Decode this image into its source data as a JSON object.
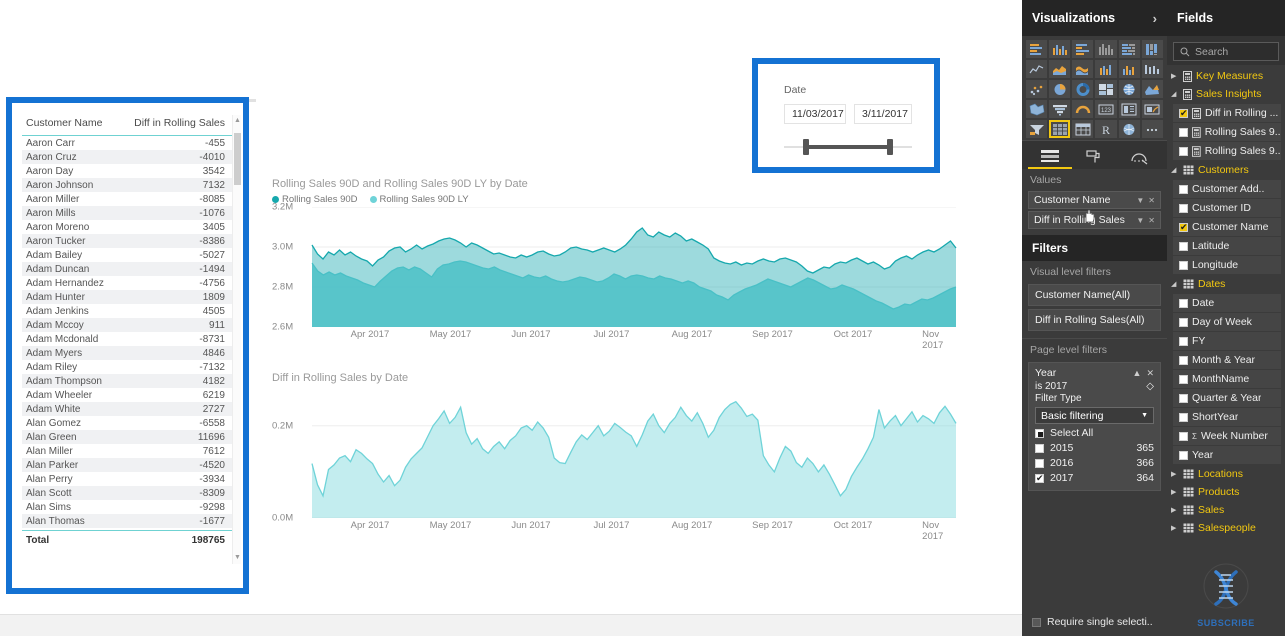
{
  "table_visual": {
    "columns": [
      "Customer Name",
      "Diff in Rolling Sales"
    ],
    "rows": [
      {
        "name": "Aaron Carr",
        "value": "-455"
      },
      {
        "name": "Aaron Cruz",
        "value": "-4010"
      },
      {
        "name": "Aaron Day",
        "value": "3542"
      },
      {
        "name": "Aaron Johnson",
        "value": "7132"
      },
      {
        "name": "Aaron Miller",
        "value": "-8085"
      },
      {
        "name": "Aaron Mills",
        "value": "-1076"
      },
      {
        "name": "Aaron Moreno",
        "value": "3405"
      },
      {
        "name": "Aaron Tucker",
        "value": "-8386"
      },
      {
        "name": "Adam Bailey",
        "value": "-5027"
      },
      {
        "name": "Adam Duncan",
        "value": "-1494"
      },
      {
        "name": "Adam Hernandez",
        "value": "-4756"
      },
      {
        "name": "Adam Hunter",
        "value": "1809"
      },
      {
        "name": "Adam Jenkins",
        "value": "4505"
      },
      {
        "name": "Adam Mccoy",
        "value": "911"
      },
      {
        "name": "Adam Mcdonald",
        "value": "-8731"
      },
      {
        "name": "Adam Myers",
        "value": "4846"
      },
      {
        "name": "Adam Riley",
        "value": "-7132"
      },
      {
        "name": "Adam Thompson",
        "value": "4182"
      },
      {
        "name": "Adam Wheeler",
        "value": "6219"
      },
      {
        "name": "Adam White",
        "value": "2727"
      },
      {
        "name": "Alan Gomez",
        "value": "-6558"
      },
      {
        "name": "Alan Green",
        "value": "11696"
      },
      {
        "name": "Alan Miller",
        "value": "7612"
      },
      {
        "name": "Alan Parker",
        "value": "-4520"
      },
      {
        "name": "Alan Perry",
        "value": "-3934"
      },
      {
        "name": "Alan Scott",
        "value": "-8309"
      },
      {
        "name": "Alan Sims",
        "value": "-9298"
      },
      {
        "name": "Alan Thomas",
        "value": "-1677"
      }
    ],
    "total_label": "Total",
    "total_value": "198765"
  },
  "date_slicer": {
    "label": "Date",
    "start": "11/03/2017",
    "end": "3/11/2017"
  },
  "chart_data": [
    {
      "type": "area",
      "title": "Rolling Sales 90D and Rolling Sales 90D LY by Date",
      "xlabel": "",
      "ylabel": "",
      "ylim": [
        2600000,
        3200000
      ],
      "yticks": [
        "2.6M",
        "2.8M",
        "3.0M",
        "3.2M"
      ],
      "xticks": [
        "Apr 2017",
        "May 2017",
        "Jun 2017",
        "Jul 2017",
        "Aug 2017",
        "Sep 2017",
        "Oct 2017",
        "Nov 2017"
      ],
      "legend": [
        {
          "name": "Rolling Sales 90D",
          "color": "#16a8ad"
        },
        {
          "name": "Rolling Sales 90D LY",
          "color": "#6fd3d8"
        }
      ],
      "grid": true,
      "series": [
        {
          "name": "Rolling Sales 90D",
          "color": "#16a8ad",
          "values": [
            3010,
            2965,
            2940,
            2975,
            2960,
            2985,
            2960,
            2975,
            2955,
            2940,
            2930,
            2905,
            2935,
            2950,
            2980,
            2995,
            3000,
            2975,
            2990,
            3010,
            2990,
            3005,
            3015,
            3030,
            3040,
            3045,
            3035,
            3020,
            3000,
            3020,
            3010,
            2995,
            2980,
            2965,
            2970,
            2960,
            2950,
            2945,
            2960,
            2950,
            2960,
            2975,
            2980,
            2965,
            2955,
            2960,
            2975,
            2995,
            3000,
            2990,
            2985,
            2975,
            2985,
            2995,
            2985,
            2975,
            2990,
            3010,
            3040,
            3075,
            3095,
            3060,
            3050,
            3075,
            3060,
            3050,
            3070,
            3055,
            3030,
            3040,
            3025,
            3010,
            2990,
            2945,
            2930,
            2920,
            2915,
            2925,
            2910,
            2920,
            2915,
            2930,
            2940,
            2930,
            2925,
            2940,
            2945,
            2935,
            2925,
            2905,
            2880,
            2870,
            2885,
            2900,
            2895,
            2915,
            2925,
            2920,
            2935,
            2945,
            2930,
            2915,
            2925,
            2910,
            2890,
            2900,
            2930,
            2945,
            2955,
            2940,
            2960,
            2975,
            2985,
            2975,
            2990,
            3010,
            3030,
            2995
          ]
        },
        {
          "name": "Rolling Sales 90D LY",
          "color": "#6fd3d8",
          "values": [
            2920,
            2880,
            2860,
            2875,
            2860,
            2870,
            2855,
            2845,
            2835,
            2820,
            2810,
            2800,
            2830,
            2855,
            2880,
            2895,
            2900,
            2885,
            2900,
            2890,
            2870,
            2850,
            2890,
            2910,
            2915,
            2925,
            2930,
            2925,
            2915,
            2905,
            2895,
            2890,
            2900,
            2885,
            2875,
            2865,
            2855,
            2845,
            2860,
            2850,
            2845,
            2855,
            2840,
            2830,
            2825,
            2830,
            2840,
            2850,
            2845,
            2835,
            2825,
            2830,
            2845,
            2865,
            2855,
            2840,
            2855,
            2860,
            2855,
            2845,
            2840,
            2855,
            2845,
            2840,
            2830,
            2820,
            2830,
            2820,
            2800,
            2790,
            2780,
            2760,
            2750,
            2735,
            2760,
            2775,
            2790,
            2800,
            2810,
            2825,
            2840,
            2830,
            2820,
            2810,
            2800,
            2815,
            2830,
            2845,
            2835,
            2820,
            2805,
            2790,
            2795,
            2810,
            2800,
            2790,
            2775,
            2760,
            2745,
            2730,
            2720,
            2705,
            2690,
            2700,
            2715,
            2710,
            2725,
            2740,
            2735,
            2745,
            2760,
            2775,
            2790,
            2800
          ]
        }
      ]
    },
    {
      "type": "area",
      "title": "Diff in Rolling Sales by Date",
      "xlabel": "",
      "ylabel": "",
      "ylim": [
        0,
        260000
      ],
      "yticks": [
        "0.0M",
        "0.2M"
      ],
      "xticks": [
        "Apr 2017",
        "May 2017",
        "Jun 2017",
        "Jul 2017",
        "Aug 2017",
        "Sep 2017",
        "Oct 2017",
        "Nov 2017"
      ],
      "legend": [],
      "grid": true,
      "series": [
        {
          "name": "Diff in Rolling Sales",
          "color": "#6fd3d8",
          "values": [
            118,
            72,
            48,
            105,
            115,
            130,
            135,
            122,
            148,
            140,
            128,
            118,
            95,
            78,
            92,
            70,
            82,
            110,
            128,
            140,
            152,
            176,
            200,
            215,
            232,
            205,
            218,
            240,
            185,
            160,
            172,
            150,
            140,
            155,
            165,
            150,
            168,
            178,
            195,
            200,
            190,
            208,
            195,
            175,
            130,
            120,
            118,
            142,
            165,
            180,
            170,
            185,
            200,
            178,
            188,
            205,
            196,
            186,
            178,
            155,
            180,
            210,
            225,
            200,
            185,
            205,
            218,
            240,
            222,
            210,
            228,
            205,
            175,
            190,
            218,
            235,
            246,
            252,
            238,
            220,
            225,
            212,
            135,
            115,
            100,
            130,
            155,
            145,
            120,
            110,
            130,
            118,
            100,
            115,
            95,
            72,
            48,
            62,
            90,
            110,
            128,
            150,
            175,
            235,
            195,
            210,
            222,
            200,
            215,
            230,
            208,
            222,
            215,
            205,
            228,
            242,
            225,
            205
          ]
        }
      ]
    }
  ],
  "visualizations": {
    "title": "Visualizations",
    "collapse_icon": "chevron-right-icon",
    "icons": [
      "stacked-bar-chart",
      "stacked-column-chart",
      "clustered-bar-chart",
      "clustered-column-chart",
      "100-stacked-bar-chart",
      "100-stacked-column-chart",
      "line-chart",
      "area-chart",
      "stacked-area-chart",
      "line-and-stacked-column-chart",
      "line-and-clustered-column-chart",
      "ribbon-chart",
      "scatter-chart",
      "pie-chart",
      "donut-chart",
      "treemap",
      "map",
      "filled-map",
      "shape-map",
      "funnel-chart",
      "gauge-chart",
      "card",
      "multi-row-card",
      "kpi",
      "slicer",
      "table",
      "matrix",
      "r-script-visual",
      "python-visual",
      "more-options"
    ],
    "selected_icon": "table",
    "tabs": [
      "fields-tab",
      "format-tab",
      "analytics-tab"
    ],
    "active_tab": "fields-tab",
    "values_section_label": "Values",
    "values": [
      "Customer Name",
      "Diff in Rolling Sales"
    ]
  },
  "filters": {
    "title": "Filters",
    "visual_level_label": "Visual level filters",
    "visual_level": [
      "Customer Name(All)",
      "Diff in Rolling Sales(All)"
    ],
    "page_level_label": "Page level filters",
    "page_filter": {
      "field": "Year",
      "condition": "is 2017",
      "filter_type_label": "Filter Type",
      "filter_type_value": "Basic filtering",
      "select_all_label": "Select All",
      "items": [
        {
          "label": "2015",
          "count": "365",
          "checked": false
        },
        {
          "label": "2016",
          "count": "366",
          "checked": false
        },
        {
          "label": "2017",
          "count": "364",
          "checked": true
        }
      ]
    },
    "require_single_label": "Require single selecti.."
  },
  "fields": {
    "title": "Fields",
    "search_placeholder": "Search",
    "tree": [
      {
        "kind": "table",
        "label": "Key Measures",
        "expanded": false,
        "icon": "measure-table-icon"
      },
      {
        "kind": "table",
        "label": "Sales Insights",
        "expanded": true,
        "icon": "measure-table-icon"
      },
      {
        "kind": "field",
        "label": "Diff in Rolling ...",
        "checked": true,
        "icon": "measure-icon"
      },
      {
        "kind": "field",
        "label": "Rolling Sales 9...",
        "checked": false,
        "icon": "measure-icon"
      },
      {
        "kind": "field",
        "label": "Rolling Sales 9...",
        "checked": false,
        "icon": "measure-icon"
      },
      {
        "kind": "table",
        "label": "Customers",
        "expanded": true,
        "icon": "table-icon"
      },
      {
        "kind": "field",
        "label": "Customer Add..",
        "checked": false,
        "icon": ""
      },
      {
        "kind": "field",
        "label": "Customer ID",
        "checked": false,
        "icon": ""
      },
      {
        "kind": "field",
        "label": "Customer Name",
        "checked": true,
        "icon": ""
      },
      {
        "kind": "field",
        "label": "Latitude",
        "checked": false,
        "icon": ""
      },
      {
        "kind": "field",
        "label": "Longitude",
        "checked": false,
        "icon": ""
      },
      {
        "kind": "table",
        "label": "Dates",
        "expanded": true,
        "icon": "table-icon"
      },
      {
        "kind": "field",
        "label": "Date",
        "checked": false,
        "icon": ""
      },
      {
        "kind": "field",
        "label": "Day of Week",
        "checked": false,
        "icon": ""
      },
      {
        "kind": "field",
        "label": "FY",
        "checked": false,
        "icon": ""
      },
      {
        "kind": "field",
        "label": "Month & Year",
        "checked": false,
        "icon": ""
      },
      {
        "kind": "field",
        "label": "MonthName",
        "checked": false,
        "icon": ""
      },
      {
        "kind": "field",
        "label": "Quarter & Year",
        "checked": false,
        "icon": ""
      },
      {
        "kind": "field",
        "label": "ShortYear",
        "checked": false,
        "icon": ""
      },
      {
        "kind": "field",
        "label": "Week Number",
        "checked": false,
        "icon": "sigma"
      },
      {
        "kind": "field",
        "label": "Year",
        "checked": false,
        "icon": ""
      },
      {
        "kind": "table",
        "label": "Locations",
        "expanded": false,
        "icon": "table-icon"
      },
      {
        "kind": "table",
        "label": "Products",
        "expanded": false,
        "icon": "table-icon"
      },
      {
        "kind": "table",
        "label": "Sales",
        "expanded": false,
        "icon": "table-icon"
      },
      {
        "kind": "table",
        "label": "Salespeople",
        "expanded": false,
        "icon": "table-icon"
      }
    ],
    "watermark_label": "SUBSCRIBE"
  },
  "colors": {
    "selection_blue": "#1472d3",
    "accent_yellow": "#f2c811",
    "series_primary": "#16a8ad",
    "series_secondary": "#6fd3d8",
    "panel_bg": "#3b3b3b"
  }
}
